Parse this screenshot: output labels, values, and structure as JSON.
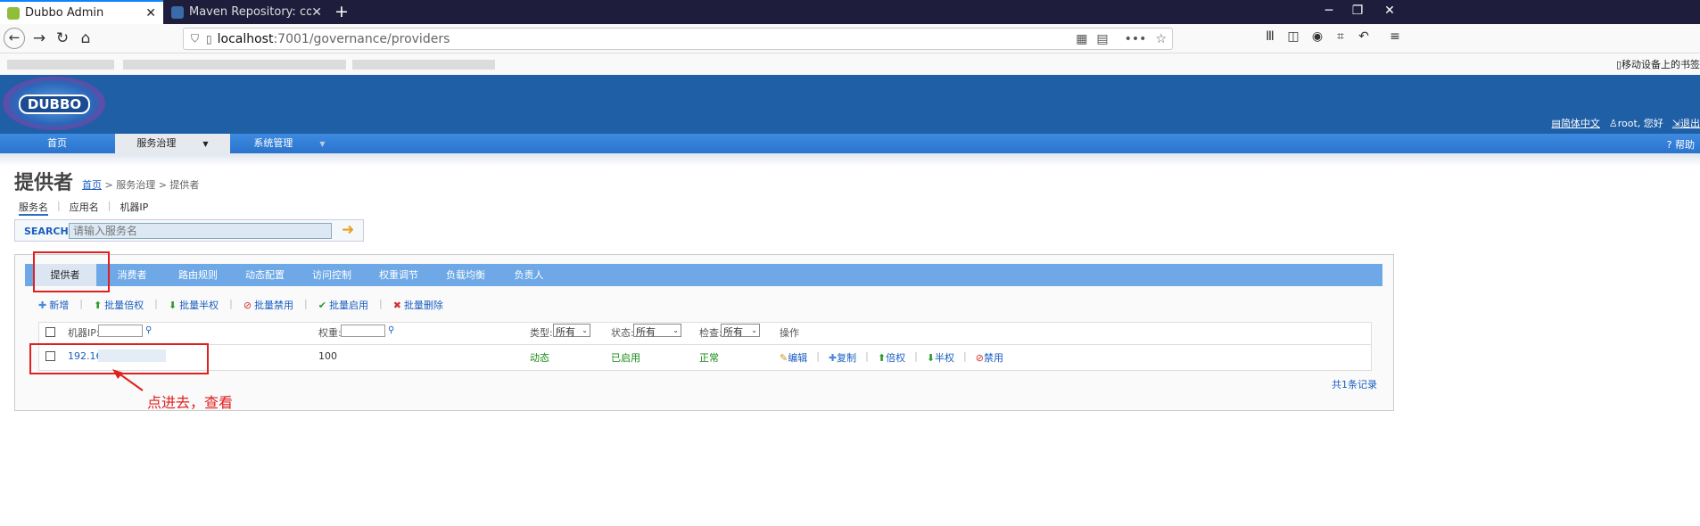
{
  "browser": {
    "tabs": [
      {
        "title": "Dubbo Admin"
      },
      {
        "title": "Maven Repository: com.githu"
      }
    ],
    "url_host": "localhost",
    "url_path": ":7001/governance/providers",
    "bookmark_right": "移动设备上的书签"
  },
  "header": {
    "logo_text": "DUBBO",
    "links": [
      "简体中文",
      "root, 您好",
      "退出"
    ]
  },
  "menu": {
    "items": [
      "首页",
      "服务治理",
      "系统管理"
    ],
    "help": "帮助"
  },
  "page": {
    "title": "提供者",
    "breadcrumb": {
      "home": "首页",
      "rest": " > 服务治理 > 提供者"
    },
    "query_tabs": [
      "服务名",
      "应用名",
      "机器IP"
    ],
    "search_label": "SEARCH",
    "search_placeholder": "请输入服务名"
  },
  "panel_tabs": [
    "提供者",
    "消费者",
    "路由规则",
    "动态配置",
    "访问控制",
    "权重调节",
    "负载均衡",
    "负责人"
  ],
  "actions": [
    "新增",
    "批量倍权",
    "批量半权",
    "批量禁用",
    "批量启用",
    "批量删除"
  ],
  "table": {
    "headers": {
      "ip": "机器IP:",
      "weight": "权重:",
      "type": "类型:",
      "status": "状态:",
      "check": "检查:",
      "ops": "操作"
    },
    "filter_all": "所有",
    "row": {
      "ip": "192.16",
      "weight": "100",
      "type": "动态",
      "status": "已启用",
      "check": "正常"
    },
    "row_ops": [
      "编辑",
      "复制",
      "倍权",
      "半权",
      "禁用"
    ],
    "count": "共1条记录"
  },
  "annotation": "点进去，查看",
  "colors": {
    "accent": "#1f5fa6",
    "annotation": "#e02020"
  }
}
